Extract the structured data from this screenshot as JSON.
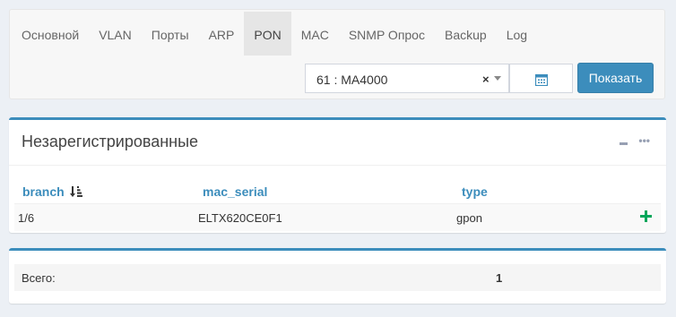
{
  "tabs": [
    {
      "label": "Основной"
    },
    {
      "label": "VLAN"
    },
    {
      "label": "Порты"
    },
    {
      "label": "ARP"
    },
    {
      "label": "PON",
      "active": true
    },
    {
      "label": "MAC"
    },
    {
      "label": "SNMP Опрос"
    },
    {
      "label": "Backup"
    },
    {
      "label": "Log"
    }
  ],
  "device_select": {
    "value": "61 : MA4000",
    "clear": "×"
  },
  "show_button": "Показать",
  "unregistered": {
    "title": "Незарегистрированные",
    "columns": [
      "branch",
      "mac_serial",
      "type"
    ],
    "sort_icon": "sort-amount-down-icon",
    "rows": [
      {
        "branch": "1/6",
        "mac_serial": "ELTX620CE0F1",
        "type": "gpon"
      }
    ]
  },
  "total": {
    "label": "Всего:",
    "value": "1"
  },
  "colors": {
    "accent": "#3c8dbc",
    "add": "#00a65a"
  }
}
